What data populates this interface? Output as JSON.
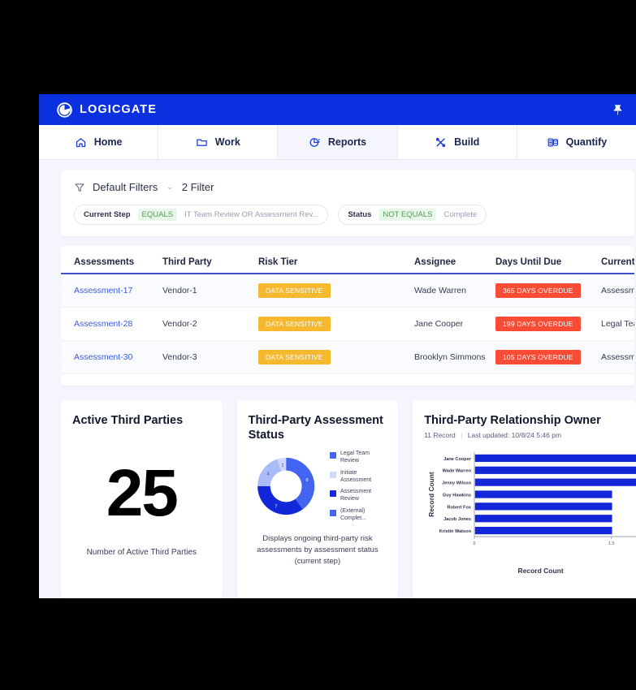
{
  "app": {
    "brand_name": "LOGICGATE",
    "brand_icon": "logicgate-logo-icon",
    "pin_icon": "pushpin-icon"
  },
  "nav": {
    "tabs": [
      {
        "label": "Home",
        "icon": "home-icon",
        "active": false
      },
      {
        "label": "Work",
        "icon": "folder-icon",
        "active": false
      },
      {
        "label": "Reports",
        "icon": "pie-chart-icon",
        "active": true
      },
      {
        "label": "Build",
        "icon": "build-icon",
        "active": false
      },
      {
        "label": "Quantify",
        "icon": "quantify-icon",
        "active": false
      }
    ]
  },
  "filters": {
    "icon": "filter-funnel-icon",
    "title": "Default Filters",
    "caret": "⌄",
    "count_label": "2 Filter",
    "chips": [
      {
        "field": "Current Step",
        "operator": "EQUALS",
        "value": "IT Team Review OR Assessment Rev..."
      },
      {
        "field": "Status",
        "operator": "NOT EQUALS",
        "value": "Complete"
      }
    ]
  },
  "table": {
    "columns": [
      "Assessments",
      "Third Party",
      "Risk Tier",
      "Assignee",
      "Days Until Due",
      "Current Step"
    ],
    "rows": [
      {
        "assessment": "Assessment-17",
        "third_party": "Vendor-1",
        "risk_tier": "DATA SENSITIVE",
        "assignee": "Wade Warren",
        "days_until_due": "365 DAYS OVERDUE",
        "current_step": "Assessment Re…"
      },
      {
        "assessment": "Assessment-28",
        "third_party": "Vendor-2",
        "risk_tier": "DATA SENSITIVE",
        "assignee": "Jane Cooper",
        "days_until_due": "199 DAYS OVERDUE",
        "current_step": "Legal Team Rev…"
      },
      {
        "assessment": "Assessment-30",
        "third_party": "Vendor-3",
        "risk_tier": "DATA SENSITIVE",
        "assignee": "Brooklyn Simmons",
        "days_until_due": "105 DAYS OVERDUE",
        "current_step": "Assessment Re…"
      }
    ]
  },
  "cards": {
    "kpi": {
      "title": "Active Third Parties",
      "value": "25",
      "caption": "Number of Active Third Parties"
    },
    "donut": {
      "title": "Third-Party Assessment Status",
      "description": "Displays ongoing third-party risk assessments by assessment status (current step)"
    },
    "bar": {
      "title": "Third-Party Relationship Owner",
      "record_count": "11 Record",
      "separator": "|",
      "last_updated": "Last updated: 10/8/24 5:46 pm"
    }
  },
  "colors": {
    "brand_blue": "#0b30e0",
    "accent_blue": "#3b5bdb",
    "tier_amber": "#f5b82e",
    "overdue_red": "#fa4b35",
    "chip_green": "#4f9d52",
    "page_bg": "#f5f6fd"
  },
  "chart_data": [
    {
      "type": "pie",
      "title": "Third-Party Assessment Status",
      "subtype": "donut",
      "categories": [
        "Legal Team Review",
        "Initiate Assessment",
        "Assessment Review",
        "(External) Complet..."
      ],
      "values": [
        8,
        1,
        7,
        4
      ],
      "slice_labels": [
        "8",
        "1",
        "7",
        "4"
      ],
      "colors": [
        "#4264f0",
        "#cdd8fb",
        "#1228d8",
        "#a9bcf7"
      ],
      "legend": {
        "position": "right",
        "entries": [
          {
            "label": "Legal Team Review",
            "color": "#4264f0"
          },
          {
            "label": "Initiate Assessment",
            "color": "#cdd8fb"
          },
          {
            "label": "Assessment Review",
            "color": "#1228d8"
          },
          {
            "label": "(External) Complet...",
            "color": "#4264f0"
          }
        ]
      }
    },
    {
      "type": "bar",
      "orientation": "horizontal",
      "title": "Third-Party Relationship Owner",
      "categories": [
        "Jane Cooper",
        "Wade Warren",
        "Jenny Wilson",
        "Guy Hawkins",
        "Robert Fox",
        "Jacob Jones",
        "Kristin Watson"
      ],
      "values": [
        2,
        2,
        2,
        1.5,
        1.5,
        1.5,
        1.5
      ],
      "xlabel": "Record Count",
      "ylabel": "Record Count",
      "xticks": [
        "0",
        "1.5"
      ],
      "xlim": [
        0,
        2
      ],
      "bar_color": "#1228d8",
      "grid": false,
      "note": "three longest bars are clipped by the card edge"
    }
  ]
}
